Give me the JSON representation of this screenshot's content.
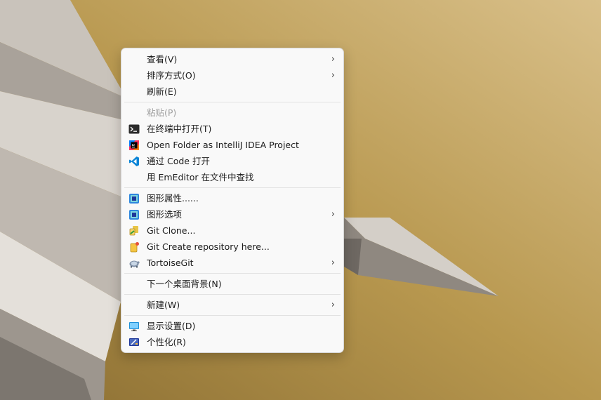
{
  "desktop": {
    "wallpaper": "paper-plane-gold-wallpaper"
  },
  "menu": {
    "items": [
      {
        "label": "查看(V)",
        "submenu": true
      },
      {
        "label": "排序方式(O)",
        "submenu": true
      },
      {
        "label": "刷新(E)"
      },
      {
        "label": "粘贴(P)",
        "disabled": true
      },
      {
        "label": "在终端中打开(T)",
        "icon": "terminal-icon"
      },
      {
        "label": "Open Folder as IntelliJ IDEA Project",
        "icon": "intellij-icon"
      },
      {
        "label": "通过 Code 打开",
        "icon": "vscode-icon"
      },
      {
        "label": "用 EmEditor 在文件中查找"
      },
      {
        "label": "图形属性......",
        "icon": "graphics-properties-icon"
      },
      {
        "label": "图形选项",
        "icon": "graphics-options-icon",
        "submenu": true
      },
      {
        "label": "Git Clone...",
        "icon": "git-clone-icon"
      },
      {
        "label": "Git Create repository here...",
        "icon": "git-create-repo-icon"
      },
      {
        "label": "TortoiseGit",
        "icon": "tortoisegit-icon",
        "submenu": true
      },
      {
        "label": "下一个桌面背景(N)"
      },
      {
        "label": "新建(W)",
        "submenu": true
      },
      {
        "label": "显示设置(D)",
        "icon": "display-settings-icon"
      },
      {
        "label": "个性化(R)",
        "icon": "personalize-icon"
      }
    ],
    "arrow_glyph": "›",
    "colors": {
      "background": "#f9f9f9",
      "text": "#1b1b1b",
      "disabled": "#a0a0a0",
      "separator": "#e2e2e2"
    }
  }
}
